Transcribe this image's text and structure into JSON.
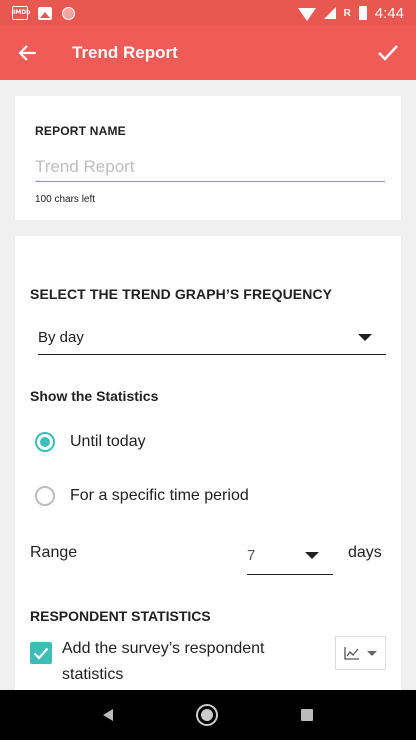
{
  "status_bar": {
    "time": "4:44",
    "r_label": "R",
    "imdb": "IMDb"
  },
  "app_bar": {
    "title": "Trend Report",
    "back_icon": "arrow-left-icon",
    "confirm_icon": "check-icon"
  },
  "report": {
    "label": "REPORT NAME",
    "value": "",
    "placeholder": "Trend Report",
    "chars_left": "100 chars left"
  },
  "frequency": {
    "heading": "SELECT THE TREND GRAPH’S FREQUENCY",
    "selected": "By day"
  },
  "statistics": {
    "heading": "Show the Statistics",
    "options": [
      {
        "label": "Until today",
        "checked": true
      },
      {
        "label": "For a specific time period",
        "checked": false
      }
    ],
    "range_label": "Range",
    "range_value": "7",
    "range_unit": "days"
  },
  "respondent": {
    "heading": "RESPONDENT STATISTICS",
    "checkbox_label": "Add the survey’s respondent statistics",
    "checked": true,
    "chart_type_icon": "line-chart-icon"
  },
  "colors": {
    "accent": "#3ebdb6",
    "app_bar": "#ef5b57",
    "status_bar": "#e85750"
  }
}
